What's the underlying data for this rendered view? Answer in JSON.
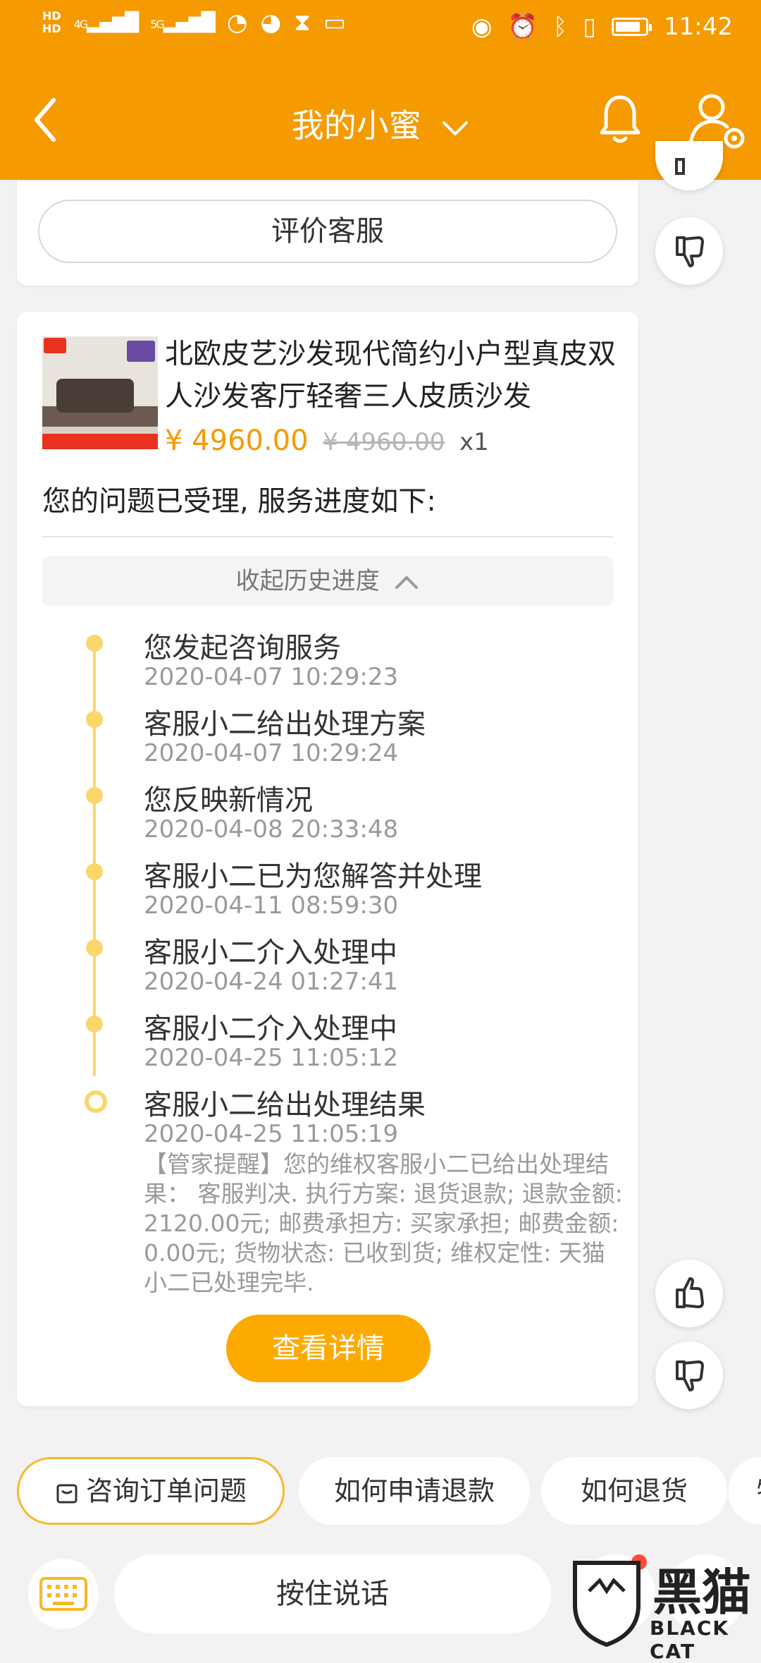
{
  "status_bar": {
    "hd1": "HD",
    "hd2": "HD",
    "net1": "4G",
    "net2": "5G",
    "time": "11:42"
  },
  "header": {
    "title": "我的小蜜"
  },
  "top_card": {
    "rate_button": "评价客服"
  },
  "product": {
    "title": "北欧皮艺沙发现代简约小户型真皮双人沙发客厅轻奢三人皮质沙发",
    "price": "¥ 4960.00",
    "original_price": "¥ 4960.00",
    "quantity": "x1"
  },
  "progress": {
    "accepted_text": "您的问题已受理, 服务进度如下:",
    "collapse_label": "收起历史进度",
    "items": [
      {
        "title": "您发起咨询服务",
        "time": "2020-04-07 10:29:23"
      },
      {
        "title": "客服小二给出处理方案",
        "time": "2020-04-07 10:29:24"
      },
      {
        "title": "您反映新情况",
        "time": "2020-04-08 20:33:48"
      },
      {
        "title": "客服小二已为您解答并处理",
        "time": "2020-04-11 08:59:30"
      },
      {
        "title": "客服小二介入处理中",
        "time": "2020-04-24 01:27:41"
      },
      {
        "title": "客服小二介入处理中",
        "time": "2020-04-25 11:05:12"
      },
      {
        "title": "客服小二给出处理结果",
        "time": "2020-04-25 11:05:19"
      }
    ],
    "note": "【管家提醒】您的维权客服小二已给出处理结果： 客服判决. 执行方案: 退货退款; 退款金额: 2120.00元; 邮费承担方: 买家承担; 邮费金额: 0.00元; 货物状态: 已收到货; 维权定性: 天猫小二已处理完毕.",
    "detail_button": "查看详情"
  },
  "quick_chips": [
    "咨询订单问题",
    "如何申请退款",
    "如何退货",
    "物"
  ],
  "input_bar": {
    "hold_to_talk": "按住说话"
  },
  "watermark": {
    "text": "黑猫",
    "sub": "BLACK CAT"
  },
  "colors": {
    "brand_orange": "#f59a00",
    "button_orange": "#fdaa00",
    "timeline_yellow": "#fbd66a"
  }
}
